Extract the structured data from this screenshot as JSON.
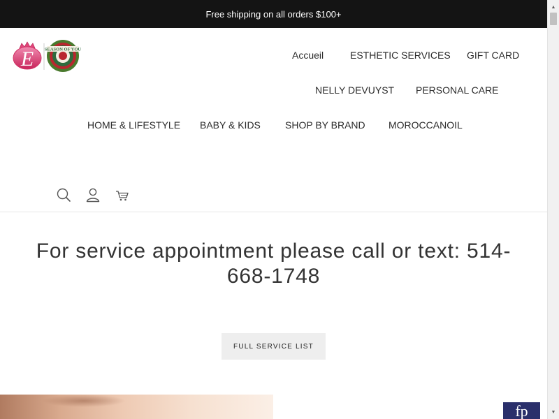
{
  "announcement": {
    "text": "Free shipping on all orders $100+"
  },
  "logo": {
    "monogram": "E",
    "seal_text": "SEASON OF YOU"
  },
  "nav": {
    "items": [
      {
        "label": "Accueil"
      },
      {
        "label": "ESTHETIC SERVICES"
      },
      {
        "label": "GIFT CARD"
      },
      {
        "label": "NELLY DEVUYST"
      },
      {
        "label": "PERSONAL CARE"
      },
      {
        "label": "HOME & LIFESTYLE"
      },
      {
        "label": "BABY & KIDS"
      },
      {
        "label": "SHOP BY BRAND"
      },
      {
        "label": "MOROCCANOIL"
      }
    ]
  },
  "header_icons": [
    "search-icon",
    "account-icon",
    "cart-icon"
  ],
  "main": {
    "headline": "For service appointment please call or text: 514-668-1748",
    "button_label": "FULL SERVICE LIST"
  },
  "brand_badge": {
    "text": "fp"
  },
  "colors": {
    "announce_bg": "#141414",
    "text": "#2b2b2b",
    "button_bg": "#eeeeee",
    "accent_pink": "#d63a6e",
    "badge_bg": "#2a2f6b"
  }
}
